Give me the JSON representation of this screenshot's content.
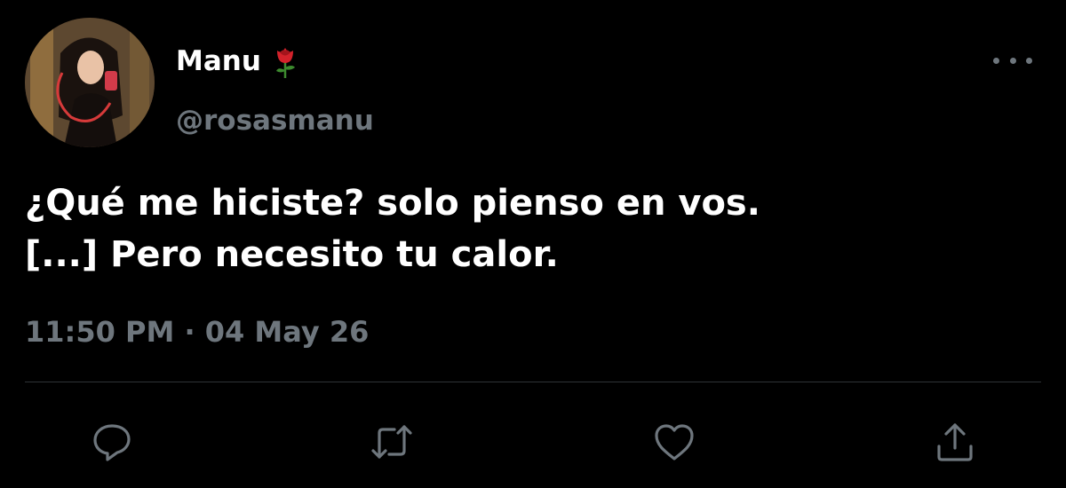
{
  "tweet": {
    "author": {
      "display_name": "Manu",
      "handle": "@rosasmanu",
      "name_emoji": "rose-icon"
    },
    "text_lines": [
      "¿Qué me hiciste? solo pienso en vos.",
      "[...] Pero necesito tu calor."
    ],
    "timestamp": "11:50 PM · 04 May 26"
  },
  "actions": [
    "reply-icon",
    "retweet-icon",
    "like-icon",
    "share-icon"
  ],
  "colors": {
    "background": "#000000",
    "text_primary": "#ffffff",
    "text_secondary": "#6e767d",
    "divider": "#2f3336"
  }
}
